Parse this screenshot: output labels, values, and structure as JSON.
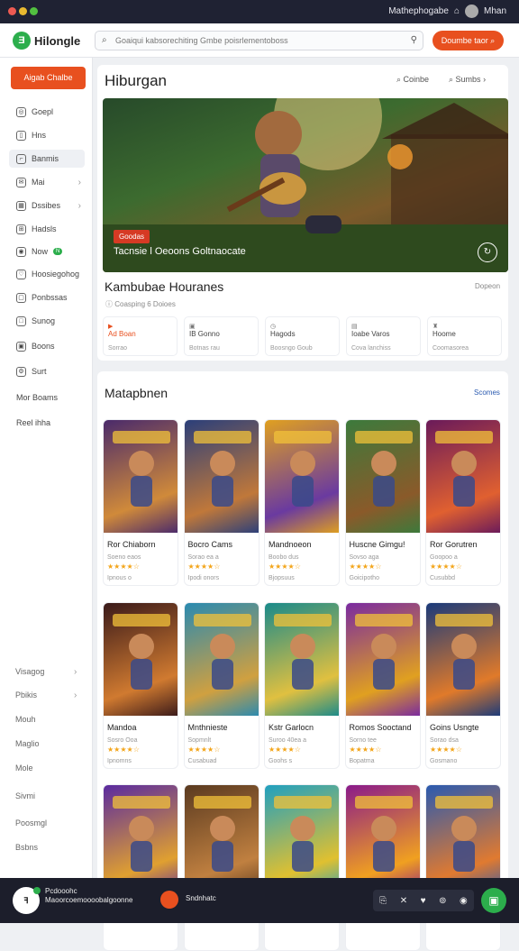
{
  "window": {
    "title": "Mathephogabe",
    "user": "Mhan"
  },
  "header": {
    "logo": "Hilongle",
    "search_placeholder": "Goaiqui kabsorechiting Gmbe poisrlementoboss",
    "button": "Doumbe taor"
  },
  "sidebar": {
    "primary_button": "Aigab Chalbe",
    "items": [
      {
        "label": "Goepl",
        "icon": "compass-icon"
      },
      {
        "label": "Hns",
        "icon": "book-icon"
      },
      {
        "label": "Banmis",
        "icon": "bookmark-icon"
      },
      {
        "label": "Mai",
        "icon": "mail-icon"
      },
      {
        "label": "Dssibes",
        "icon": "grid-icon"
      },
      {
        "label": "Hadsls",
        "icon": "gamepad-icon"
      },
      {
        "label": "Now",
        "icon": "new-icon",
        "badge": "N"
      },
      {
        "label": "Hoosiegohog",
        "icon": "heart-icon"
      },
      {
        "label": "Ponbssas",
        "icon": "chat-icon"
      },
      {
        "label": "Sunog",
        "icon": "square-icon"
      },
      {
        "label": "Boons",
        "icon": "photo-icon"
      },
      {
        "label": "Surt",
        "icon": "settings-icon"
      },
      {
        "label": "Mor Boams",
        "icon": "none"
      },
      {
        "label": "Reel ihha",
        "icon": "none"
      }
    ],
    "footer": [
      "Visagog",
      "Pbikis",
      "Mouh",
      "Maglio",
      "Mole",
      "Sivmi",
      "Poosmgl",
      "Bsbns"
    ]
  },
  "featured": {
    "heading": "Hiburgan",
    "filter": "Coinbe",
    "sort": "Sumbs",
    "ribbon": "Goodas",
    "hero_title": "Tacnsie l Oeoons  Goltnaocate",
    "title": "Kambubae Houranes",
    "meta": "Coasping 6 Doioes",
    "link": "Dopeon",
    "tiles": [
      {
        "label": "Ad Boan",
        "sub": "Sorrao",
        "icon": "play-icon"
      },
      {
        "label": "IB Gonno",
        "sub": "Botnas rau",
        "icon": "image-icon"
      },
      {
        "label": "Hagods",
        "sub": "Boosngo Goub",
        "icon": "clock-icon"
      },
      {
        "label": "Ioabe Varos",
        "sub": "Cova lanchiss",
        "icon": "chart-icon"
      },
      {
        "label": "Hoome",
        "sub": "Coomasorea",
        "icon": "trophy-icon"
      }
    ]
  },
  "games_section": {
    "heading": "Matapbnen",
    "link": "Scomes",
    "games": [
      {
        "name": "Ror Chiaborn",
        "sub": "Soeno eaos",
        "stars": "★★★★☆",
        "sub2": "Ipnous o",
        "colors": [
          "#4a2a6b",
          "#d08a3a"
        ]
      },
      {
        "name": "Bocro Cams",
        "sub": "Sorao ea a",
        "stars": "★★★★☆",
        "sub2": "Ipodi onors",
        "colors": [
          "#2b3f7a",
          "#c0783a"
        ]
      },
      {
        "name": "Mandnoeon",
        "sub": "Boobo dus",
        "stars": "★★★★☆",
        "sub2": "Bjopsuus",
        "colors": [
          "#e0a020",
          "#6a3aa0"
        ]
      },
      {
        "name": "Huscne Gimgu!",
        "sub": "Sovso aga",
        "stars": "★★★★☆",
        "sub2": "Goicipotho",
        "colors": [
          "#3c7a3c",
          "#8a5a2a"
        ]
      },
      {
        "name": "Ror Gorutren",
        "sub": "Goopoo a",
        "stars": "★★★★☆",
        "sub2": "Cusubbd",
        "colors": [
          "#6a1a5a",
          "#e06030"
        ]
      },
      {
        "name": "Mandoa",
        "sub": "Sosro Ooa",
        "stars": "★★★★☆",
        "sub2": "Ipnomns",
        "colors": [
          "#3a1a1a",
          "#d07a30"
        ]
      },
      {
        "name": "Mnthnieste",
        "sub": "Sopmnlt",
        "stars": "★★★★☆",
        "sub2": "Cusabuad",
        "colors": [
          "#2a8ab0",
          "#d0a040"
        ]
      },
      {
        "name": "Kstr Garlocn",
        "sub": "Suroo 40ea a",
        "stars": "★★★★☆",
        "sub2": "Goohs s",
        "colors": [
          "#1a8a8a",
          "#e0c040"
        ]
      },
      {
        "name": "Romos Sooctand",
        "sub": "Sorno tee",
        "stars": "★★★★☆",
        "sub2": "Bopatma",
        "colors": [
          "#7a2aa0",
          "#e0a020"
        ]
      },
      {
        "name": "Goins Usngte",
        "sub": "Sorao dsa",
        "stars": "★★★★☆",
        "sub2": "Gosmano",
        "colors": [
          "#1a3a7a",
          "#e07a2a"
        ]
      },
      {
        "name": "",
        "sub": "",
        "stars": "",
        "sub2": "",
        "colors": [
          "#5a2aa0",
          "#e0a030"
        ]
      },
      {
        "name": "",
        "sub": "",
        "stars": "",
        "sub2": "",
        "colors": [
          "#5a3a20",
          "#c08040"
        ]
      },
      {
        "name": "",
        "sub": "",
        "stars": "",
        "sub2": "",
        "colors": [
          "#20a0c0",
          "#e0c030"
        ]
      },
      {
        "name": "",
        "sub": "",
        "stars": "",
        "sub2": "",
        "colors": [
          "#8a1a8a",
          "#f0a020"
        ]
      },
      {
        "name": "",
        "sub": "",
        "stars": "",
        "sub2": "",
        "colors": [
          "#2a5ab0",
          "#e07a30"
        ]
      }
    ]
  },
  "bottom_bar": {
    "line1": "Pcdooohc",
    "line2": "Maoorcoemoooobalgoonne",
    "mid": "Sndnhatc"
  }
}
